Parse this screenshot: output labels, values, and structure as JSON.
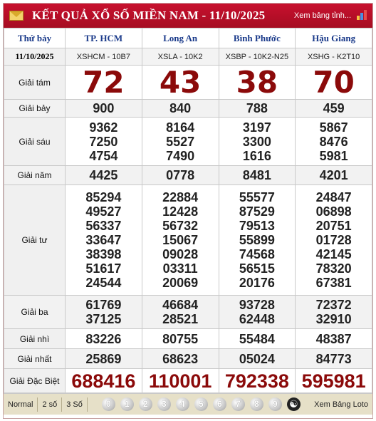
{
  "header": {
    "title": "KẾT QUẢ XỔ SỐ MIỀN NAM - 11/10/2025",
    "view_all": "Xem bảng tỉnh..."
  },
  "colors": {
    "header_red": "#c8102e",
    "prize_red": "#8b0a0a",
    "province_blue": "#1a3a8a"
  },
  "table": {
    "day": "Thứ bảy",
    "date": "11/10/2025",
    "provinces": [
      {
        "name": "TP. HCM",
        "code": "XSHCM - 10B7"
      },
      {
        "name": "Long An",
        "code": "XSLA - 10K2"
      },
      {
        "name": "Bình Phước",
        "code": "XSBP - 10K2-N25"
      },
      {
        "name": "Hậu Giang",
        "code": "XSHG - K2T10"
      }
    ],
    "labels": {
      "g8": "Giải tám",
      "g7": "Giải bảy",
      "g6": "Giải sáu",
      "g5": "Giải năm",
      "g4": "Giải tư",
      "g3": "Giải ba",
      "g2": "Giải nhì",
      "g1": "Giải nhất",
      "db": "Giải Đặc Biệt"
    },
    "g8": [
      "72",
      "43",
      "38",
      "70"
    ],
    "g7": [
      "900",
      "840",
      "788",
      "459"
    ],
    "g6": [
      [
        "9362",
        "7250",
        "4754"
      ],
      [
        "8164",
        "5527",
        "7490"
      ],
      [
        "3197",
        "3300",
        "1616"
      ],
      [
        "5867",
        "8476",
        "5981"
      ]
    ],
    "g5": [
      "4425",
      "0778",
      "8481",
      "4201"
    ],
    "g4": [
      [
        "85294",
        "49527",
        "56337",
        "33647",
        "38398",
        "51617",
        "24544"
      ],
      [
        "22884",
        "12428",
        "56732",
        "15067",
        "09028",
        "03311",
        "20069"
      ],
      [
        "55577",
        "87529",
        "79513",
        "55899",
        "74568",
        "56515",
        "20176"
      ],
      [
        "24847",
        "06898",
        "20751",
        "01728",
        "42145",
        "78320",
        "67381"
      ]
    ],
    "g3": [
      [
        "61769",
        "37125"
      ],
      [
        "46684",
        "28521"
      ],
      [
        "93728",
        "62448"
      ],
      [
        "72372",
        "32910"
      ]
    ],
    "g2": [
      "83226",
      "80755",
      "55484",
      "48387"
    ],
    "g1": [
      "25869",
      "68623",
      "05024",
      "84773"
    ],
    "db": [
      "688416",
      "110001",
      "792338",
      "595981"
    ]
  },
  "footer": {
    "modes": [
      "Normal",
      "2 số",
      "3 Số"
    ],
    "digits": [
      "0",
      "1",
      "2",
      "3",
      "4",
      "5",
      "6",
      "7",
      "8",
      "9"
    ],
    "loto_link": "Xem Bảng Loto"
  }
}
